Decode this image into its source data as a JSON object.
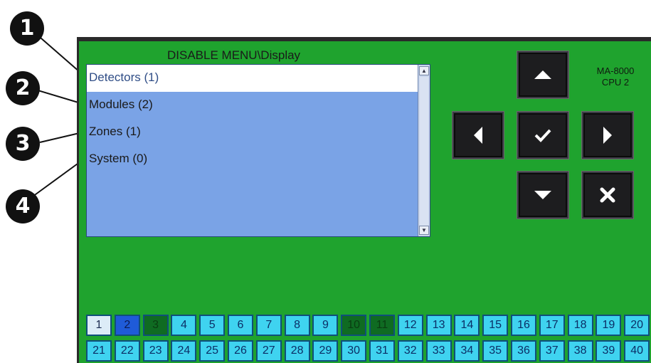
{
  "screen": {
    "title": "DISABLE MENU\\Display",
    "device_model": "MA-8000",
    "device_cpu": "CPU 2",
    "background_color": "#1fa32e"
  },
  "menu": {
    "items": [
      {
        "label": "Detectors (1)",
        "selected": true
      },
      {
        "label": "Modules (2)",
        "selected": false
      },
      {
        "label": "Zones (1)",
        "selected": false
      },
      {
        "label": "System (0)",
        "selected": false
      }
    ]
  },
  "nav_buttons": [
    {
      "name": "up-arrow-button",
      "icon": "triangle-up-icon"
    },
    {
      "name": "left-arrow-button",
      "icon": "triangle-left-icon"
    },
    {
      "name": "confirm-button",
      "icon": "checkmark-icon"
    },
    {
      "name": "right-arrow-button",
      "icon": "triangle-right-icon"
    },
    {
      "name": "down-arrow-button",
      "icon": "triangle-down-icon"
    },
    {
      "name": "cancel-button",
      "icon": "x-mark-icon"
    }
  ],
  "zones": {
    "row1": [
      "1",
      "2",
      "3",
      "4",
      "5",
      "6",
      "7",
      "8",
      "9",
      "10",
      "11",
      "12",
      "13",
      "14",
      "15",
      "16",
      "17",
      "18",
      "19",
      "20"
    ],
    "row2": [
      "21",
      "22",
      "23",
      "24",
      "25",
      "26",
      "27",
      "28",
      "29",
      "30",
      "31",
      "32",
      "33",
      "34",
      "35",
      "36",
      "37",
      "38",
      "39",
      "40"
    ],
    "states": {
      "1": "white",
      "2": "blue",
      "3": "green",
      "10": "green",
      "11": "green"
    }
  },
  "callouts": [
    "1",
    "2",
    "3",
    "4"
  ]
}
